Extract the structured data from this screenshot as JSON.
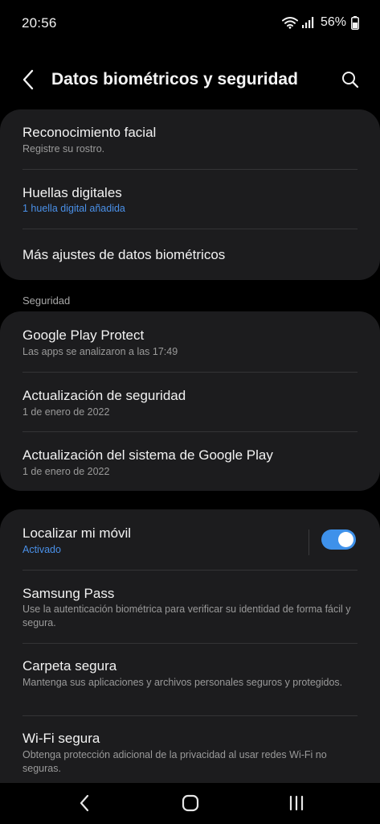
{
  "status_bar": {
    "time": "20:56",
    "battery_percent": "56%",
    "icons": [
      "wifi-icon",
      "signal-icon",
      "battery-icon"
    ]
  },
  "header": {
    "title": "Datos biométricos y seguridad",
    "back_icon": "back-arrow-icon",
    "search_icon": "search-icon"
  },
  "biometrics": {
    "items": [
      {
        "title": "Reconocimiento facial",
        "subtitle": "Registre su rostro."
      },
      {
        "title": "Huellas digitales",
        "subtitle": "1 huella digital añadida"
      },
      {
        "title": "Más ajustes de datos biométricos"
      }
    ]
  },
  "security": {
    "header": "Seguridad",
    "items": [
      {
        "title": "Google Play Protect",
        "subtitle": "Las apps se analizaron a las 17:49"
      },
      {
        "title": "Actualización de seguridad",
        "subtitle": "1 de enero de 2022"
      },
      {
        "title": "Actualización del sistema de Google Play",
        "subtitle": "1 de enero de 2022"
      }
    ]
  },
  "more": {
    "items": [
      {
        "title": "Localizar mi móvil",
        "subtitle": "Activado",
        "toggle_on": true
      },
      {
        "title": "Samsung Pass",
        "subtitle": "Use la autenticación biométrica para verificar su identidad de forma fácil y segura."
      },
      {
        "title": "Carpeta segura",
        "subtitle": "Mantenga sus aplicaciones y archivos personales seguros y protegidos."
      },
      {
        "title": "Wi-Fi segura",
        "subtitle": "Obtenga protección adicional de la privacidad al usar redes Wi-Fi no seguras."
      }
    ]
  },
  "nav_bar": {
    "icons": [
      "back-nav-icon",
      "home-nav-icon",
      "recents-nav-icon"
    ]
  },
  "colors": {
    "background": "#000000",
    "card": "#1c1c1e",
    "accent_blue": "#4a90e8",
    "toggle_on": "#3e91ea",
    "secondary_text": "#9a9a9a"
  }
}
